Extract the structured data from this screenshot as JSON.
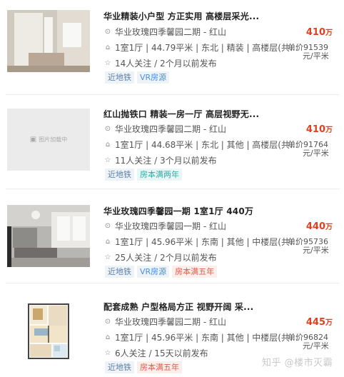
{
  "listings": [
    {
      "title": "华业精装小户型 方正实用 高楼层采光...",
      "community": "华业玫瑰四季馨园二期 - 红山",
      "attrs": "1室1厅 | 44.79平米 | 东北 | 精装 | 高楼层(共...",
      "followers": "14人关注 / 2个月以前发布",
      "tags": [
        "近地铁",
        "VR房源"
      ],
      "price": "410",
      "price_unit": "万",
      "unit_price": "单价91539",
      "unit_price_suffix": "元/平米"
    },
    {
      "title": "红山抛铁口 精装一房一厅 高层视野无...",
      "community": "华业玫瑰四季馨园二期 - 红山",
      "attrs": "1室1厅 | 44.68平米 | 东北 | 其他 | 高楼层(共...",
      "followers": "11人关注 / 3个月以前发布",
      "tags": [
        "近地铁",
        "房本满两年"
      ],
      "price": "410",
      "price_unit": "万",
      "unit_price": "单价91764",
      "unit_price_suffix": "元/平米",
      "placeholder_text": "图片加载中"
    },
    {
      "title": "华业玫瑰四季馨园一期 1室1厅 440万",
      "community": "华业玫瑰四季馨园一期 - 红山",
      "attrs": "1室1厅 | 45.96平米 | 东南 | 其他 | 中楼层(共...",
      "followers": "25人关注 / 2个月以前发布",
      "tags": [
        "近地铁",
        "VR房源",
        "房本满五年"
      ],
      "price": "440",
      "price_unit": "万",
      "unit_price": "单价95736",
      "unit_price_suffix": "元/平米"
    },
    {
      "title": "配套成熟 户型格局方正 视野开阔 采...",
      "community": "华业玫瑰四季馨园二期 - 红山",
      "attrs": "1室1厅 | 45.96平米 | 东南 | 其他 | 中楼层(共...",
      "followers": "6人关注 / 15天以前发布",
      "tags": [
        "近地铁",
        "房本满五年"
      ],
      "price": "445",
      "price_unit": "万",
      "unit_price": "单价96824",
      "unit_price_suffix": "元/平米"
    }
  ],
  "watermark": "知乎 @楼市灭霸",
  "colors": {
    "price": "#e0401f",
    "tag_subway": "#5b7fa4",
    "tag_vr": "#4f8ed6",
    "tag_tax2": "#3aa8a8",
    "tag_tax5": "#d9604a"
  }
}
